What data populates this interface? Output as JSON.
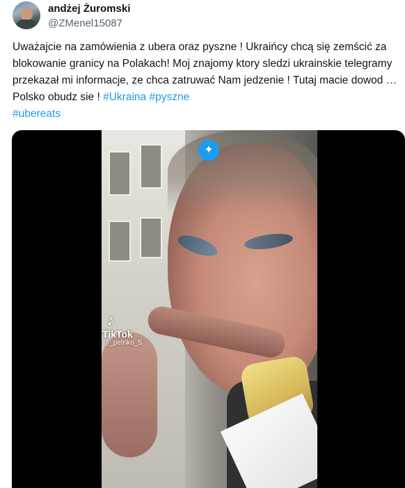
{
  "tweet": {
    "display_name": "andżej Żuromski",
    "handle": "@ZMenel15087",
    "text_before_tags": "Uważajcie na zamówienia z ubera oraz pyszne ! Ukraińcy chcą się zemścić za blokowanie granicy na Polakach!  Moj znajomy ktory sledzi ukrainskie telegramy przekazał mi informacje, ze chca zatruwać Nam jedzenie ! Tutaj macie dowod … Polsko obudz sie ! ",
    "hashtags": [
      "#Ukraina",
      "#pyszne",
      "#ubereats"
    ]
  },
  "media": {
    "watermark_logo": "♪",
    "watermark_brand": "TikTok",
    "watermark_user": "@_petriko_5",
    "sparkle_icon": "✦"
  },
  "colors": {
    "link": "#1d9bf0",
    "text": "#0f1419",
    "secondary": "#536471"
  }
}
